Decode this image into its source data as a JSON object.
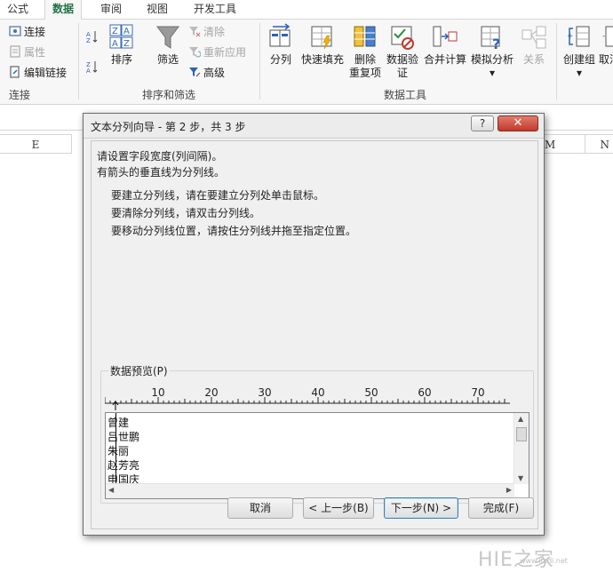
{
  "ribbon": {
    "tabs": [
      {
        "label": "公式"
      },
      {
        "label": "数据"
      },
      {
        "label": "审阅"
      },
      {
        "label": "视图"
      },
      {
        "label": "开发工具"
      }
    ],
    "groups": {
      "connections": {
        "label": "连接",
        "items": [
          {
            "label": "连接",
            "enabled": true
          },
          {
            "label": "属性",
            "enabled": false
          },
          {
            "label": "编辑链接",
            "enabled": true
          }
        ]
      },
      "sort_filter": {
        "label": "排序和筛选",
        "sort_label": "排序",
        "filter_label": "筛选",
        "clear_label": "清除",
        "reapply_label": "重新应用",
        "advanced_label": "高级"
      },
      "data_tools": {
        "label": "数据工具",
        "split_label": "分列",
        "flash_fill_label": "快速填充",
        "remove_dup_label_1": "删除",
        "remove_dup_label_2": "重复项",
        "validate_label_1": "数据验",
        "validate_label_2": "证",
        "consolidate_label": "合并计算",
        "whatif_label": "模拟分析",
        "relations_label": "关系"
      },
      "outline": {
        "group_label": "创建组",
        "ungroup_label": "取消"
      }
    }
  },
  "sheet": {
    "columns": [
      "E",
      "M",
      "N"
    ]
  },
  "dialog": {
    "title": "文本分列向导 - 第 2 步，共 3 步",
    "help": "?",
    "close": "✕",
    "instruction_1": "请设置字段宽度(列间隔)。",
    "instruction_2": "有箭头的垂直线为分列线。",
    "hint_1": "要建立分列线，请在要建立分列处单击鼠标。",
    "hint_2": "要清除分列线，请双击分列线。",
    "hint_3": "要移动分列线位置，请按住分列线并拖至指定位置。",
    "preview_label": "数据预览(P)",
    "ruler_ticks": [
      "10",
      "20",
      "30",
      "40",
      "50",
      "60",
      "70"
    ],
    "preview_rows": [
      "曾建",
      "吕世鹏",
      "朱丽",
      "赵芳亮",
      "申国庆"
    ],
    "buttons": {
      "cancel": "取消",
      "back": "< 上一步(B)",
      "next": "下一步(N) >",
      "finish": "完成(F)"
    }
  },
  "watermark": {
    "text": "HIE之家",
    "sub": "www.itsdi.net"
  }
}
